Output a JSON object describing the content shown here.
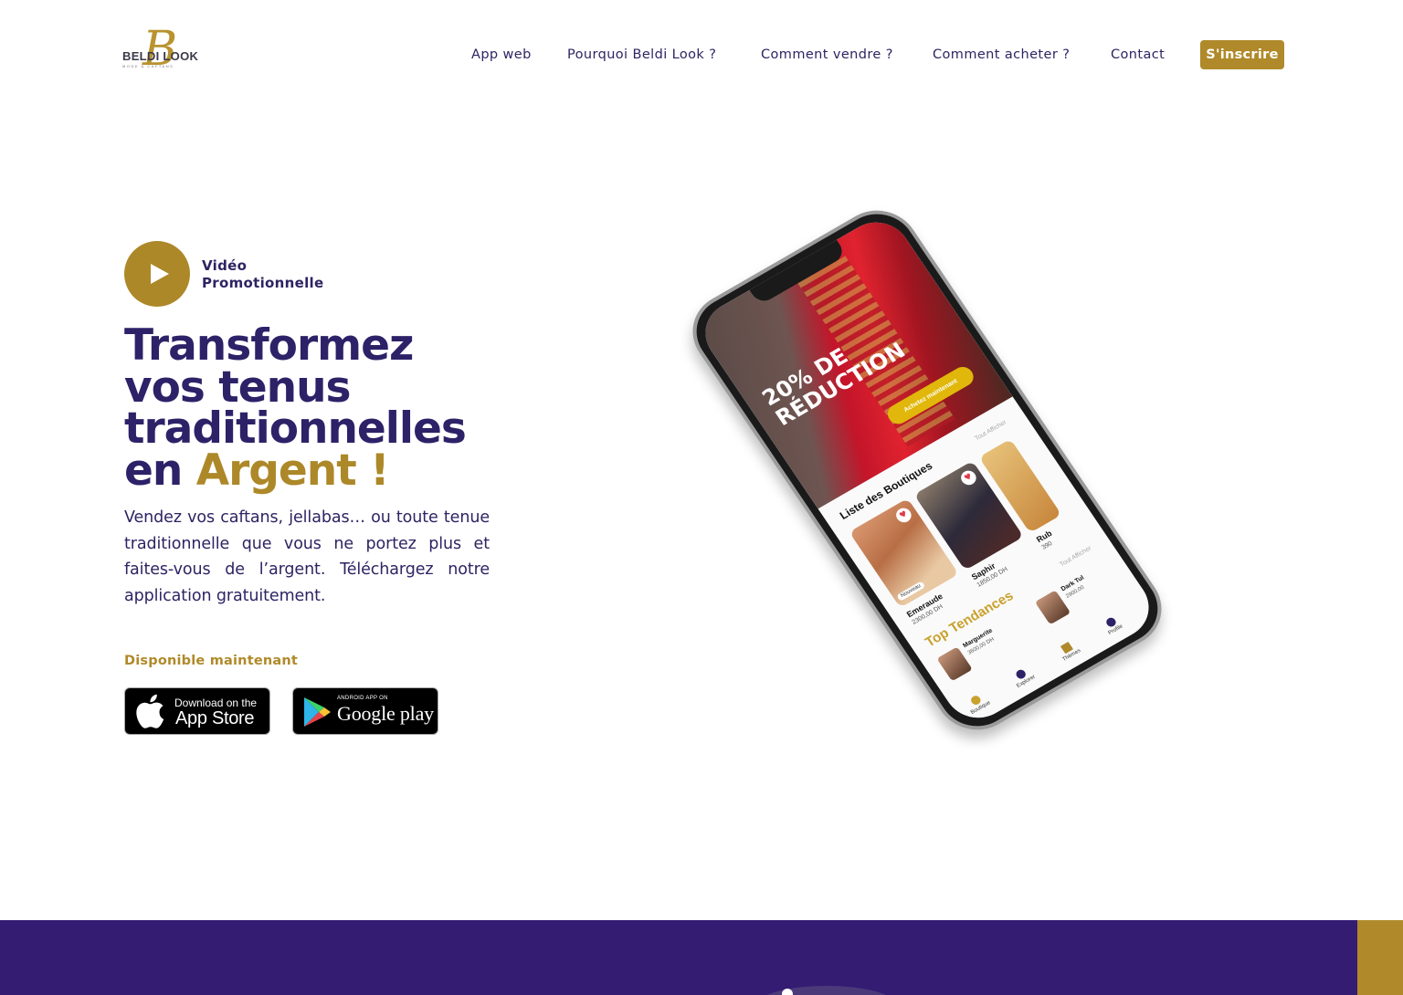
{
  "brand": {
    "logo_letter": "B",
    "logo_name": "BELDI LOOK",
    "logo_tagline": "MODE & CAFTANS"
  },
  "nav": {
    "items": [
      {
        "label": "App web"
      },
      {
        "label": "Pourquoi Beldi Look ?"
      },
      {
        "label": "Comment vendre ?"
      },
      {
        "label": "Comment acheter ?"
      },
      {
        "label": "Contact"
      }
    ],
    "signup_label": "S'inscrire"
  },
  "hero": {
    "video_label_line1": "Vidéo",
    "video_label_line2": "Promotionnelle",
    "headline_line1": "Transformez",
    "headline_line2": "vos tenus",
    "headline_line3": "traditionnelles",
    "headline_line4_prefix": "en ",
    "headline_highlight": "Argent !",
    "description": "Vendez vos caftans, jellabas… ou toute tenue traditionnelle que vous ne portez plus et faites-vous de l’argent. Téléchargez notre application gratuitement.",
    "available_label": "Disponible maintenant",
    "app_store": {
      "small": "Download on the",
      "big": "App Store"
    },
    "google_play": {
      "small": "ANDROID APP ON",
      "big": "Google play"
    }
  },
  "phone_screen": {
    "promo_line1": "20% DE",
    "promo_line2": "RÉDUCTION",
    "cta": "Achetez maintenant",
    "shops_title": "Liste des Boutiques",
    "see_all": "Tout Afficher",
    "badge_new": "Nouveau",
    "products": [
      {
        "name": "Emeraude",
        "price": "2300,00 DH"
      },
      {
        "name": "Saphir",
        "price": "1850,00 DH"
      },
      {
        "name": "Rub",
        "price": "390"
      }
    ],
    "trends_title": "Top Tendances",
    "see_all_2": "Tout Afficher",
    "trends": [
      {
        "name": "Marguerite",
        "price": "3600,00 DH"
      },
      {
        "name": "Dark Tul",
        "price": "2900,00"
      }
    ],
    "tabs": [
      "Boutique",
      "Explorer",
      "Thèmes",
      "Profile"
    ]
  },
  "colors": {
    "primary": "#2d2268",
    "gold": "#b08a2a",
    "band": "#341c73"
  }
}
